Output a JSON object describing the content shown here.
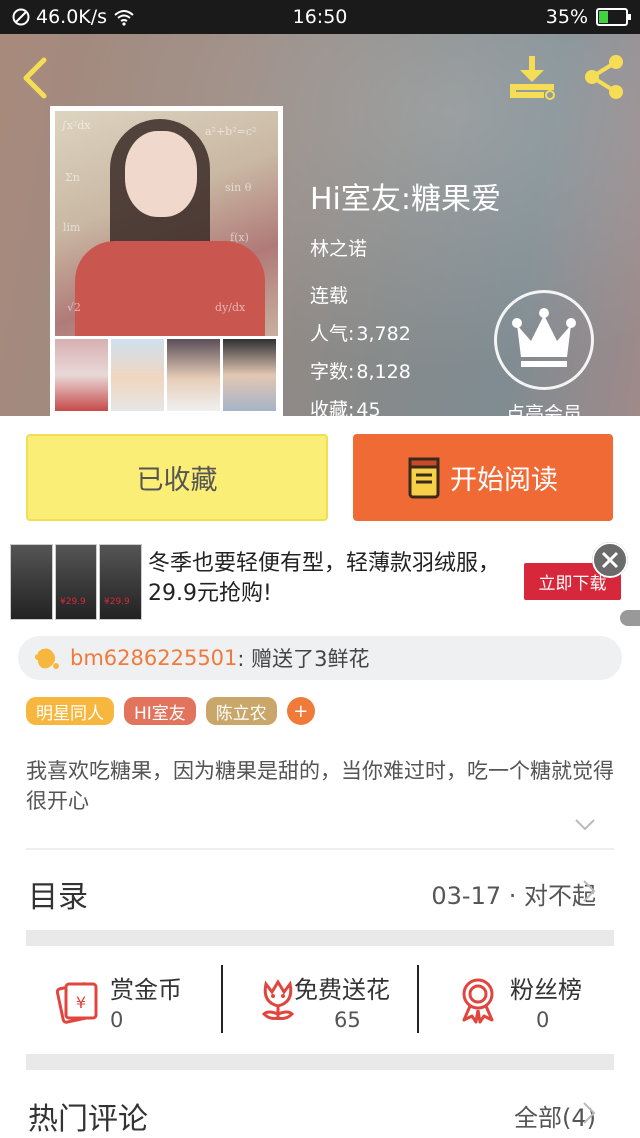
{
  "status_bar": {
    "net_speed": "46.0K/s",
    "time": "16:50",
    "battery": "35%",
    "battery_level": 0.35
  },
  "header": {
    "back_icon": "chevron-left-icon",
    "download_icon": "download-icon",
    "share_icon": "share-icon"
  },
  "book": {
    "title": "Hi室友:糖果爱",
    "author": "林之诺",
    "status": "连载",
    "popularity_label": "人气:",
    "popularity_value": "3,782",
    "word_count_label": "字数:",
    "word_count_value": "8,128",
    "favorites_label": "收藏:",
    "favorites_value": "45",
    "cover_equations": [
      "∫x²dx",
      "a²+b²=c²",
      "Σn",
      "sin θ",
      "lim",
      "f(x)",
      "dy/dx",
      "√2"
    ]
  },
  "vip": {
    "icon": "crown-icon",
    "label": "点亮会员"
  },
  "actions": {
    "collected_label": "已收藏",
    "read_label": "开始阅读",
    "read_icon": "book-icon"
  },
  "ad": {
    "text": "冬季也要轻便有型，轻薄款羽绒服，29.9元抢购!",
    "cta": "立即下载",
    "price_tags": [
      "¥29.9",
      "¥29.9"
    ],
    "close_icon": "close-icon"
  },
  "gift": {
    "icon": "flower-icon",
    "user": "bm6286225501",
    "message": ": 赠送了3鲜花"
  },
  "tags": [
    {
      "label": "明星同人",
      "color": "#f7b73e"
    },
    {
      "label": "HI室友",
      "color": "#e2745e"
    },
    {
      "label": "陈立农",
      "color": "#c9a66a"
    }
  ],
  "tag_add": "+",
  "description": "我喜欢吃糖果，因为糖果是甜的，当你难过时，吃一个糖就觉得很开心",
  "toc": {
    "label": "目录",
    "latest": "03-17 · 对不起"
  },
  "support": [
    {
      "label": "赏金币",
      "count": "0",
      "icon": "red-envelope-icon"
    },
    {
      "label": "免费送花",
      "count": "65",
      "icon": "flower-icon"
    },
    {
      "label": "粉丝榜",
      "count": "0",
      "icon": "medal-icon"
    }
  ],
  "comments": {
    "label": "热门评论",
    "all": "全部(4)"
  },
  "colors": {
    "accent_orange": "#f06a35",
    "collected_yellow": "#fbee76",
    "icon_red": "#e0463e",
    "header_icon_yellow": "#f5dd55"
  }
}
